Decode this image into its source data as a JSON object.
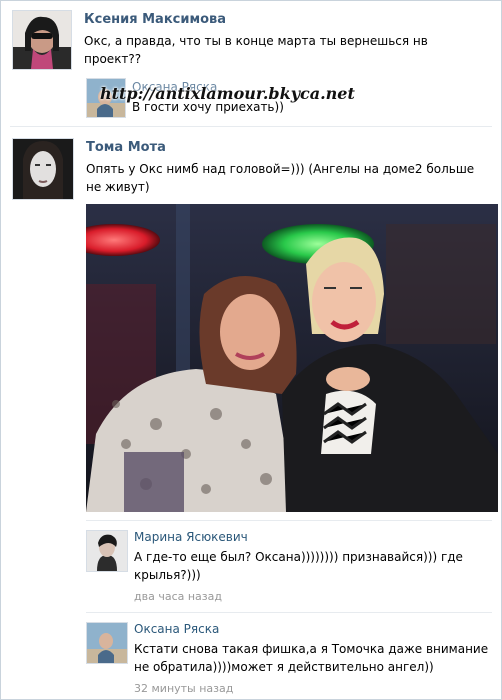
{
  "posts": [
    {
      "author": "Ксения Максимова",
      "text_line1": "Окс, а правда, что ты в конце марта ты вернешься нв",
      "text_line2": "проект??"
    },
    {
      "author": "Тома Мота",
      "text_line1": "Опять у Окс нимб над головой=))) (Ангелы на доме2 больше",
      "text_line2": "не живут)"
    }
  ],
  "reply_preview": {
    "author": "Оксана Ряска",
    "text": "В гости хочу приехать))"
  },
  "watermark": "http://antixlamour.bkyca.net",
  "comments": [
    {
      "author": "Марина Ясюкевич",
      "text_line1": "А где-то еще был? Оксана)))))))) признавайся))) где",
      "text_line2": "крылья?)))",
      "time": "два часа назад"
    },
    {
      "author": "Оксана Ряска",
      "text_line1": "Кстати снова такая фишка,а я Томочка даже внимание",
      "text_line2": "не обратила))))может я действительно ангел))",
      "time": "32 минуты назад"
    }
  ],
  "colors": {
    "link": "#2b587a",
    "author": "#3b5a7a",
    "muted": "#999999",
    "divider": "#e7ebef"
  }
}
